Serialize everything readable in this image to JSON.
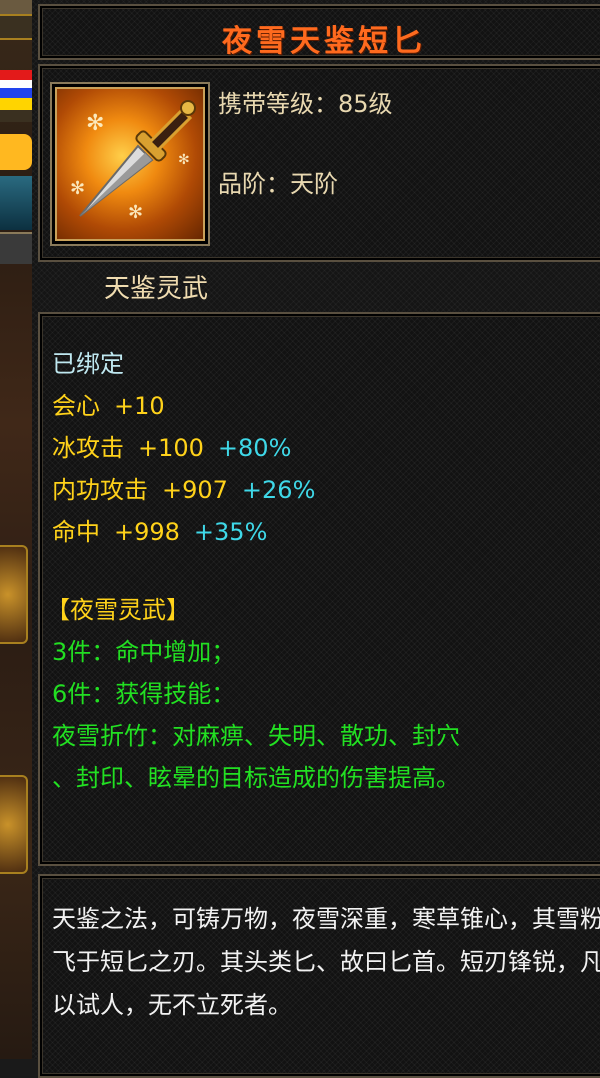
{
  "item": {
    "name": "夜雪天鉴短匕",
    "level_label": "携带等级：85级",
    "grade_label": "品阶：天阶",
    "category": "天鉴灵武"
  },
  "stats": {
    "bound": "已绑定",
    "crit": {
      "label": "会心",
      "value": "+10"
    },
    "ice_attack": {
      "label": "冰攻击",
      "value": "+100",
      "bonus": "+80%"
    },
    "internal_attack": {
      "label": "内功攻击",
      "value": "+907",
      "bonus": "+26%"
    },
    "accuracy": {
      "label": "命中",
      "value": "+998",
      "bonus": "+35%"
    }
  },
  "set": {
    "name": "【夜雪灵武】",
    "bonus_3": "3件：命中增加；",
    "bonus_6": "6件：获得技能：",
    "skill_line1": "夜雪折竹：对麻痹、失明、散功、封穴",
    "skill_line2": "、封印、眩晕的目标造成的伤害提高。"
  },
  "description": "天鉴之法，可铸万物，夜雪深重，寒草锥心，其雪粉飞于短匕之刃。其头类匕、故曰匕首。短刃锋锐，凡以试人，无不立死者。",
  "colors": {
    "title": "#ff6a1e",
    "bound": "#bfe8f0",
    "stat": "#ffd21a",
    "bonus": "#3fd8e8",
    "set": "#22e022",
    "description": "#f2f2f2"
  },
  "icon": "dagger-icon"
}
